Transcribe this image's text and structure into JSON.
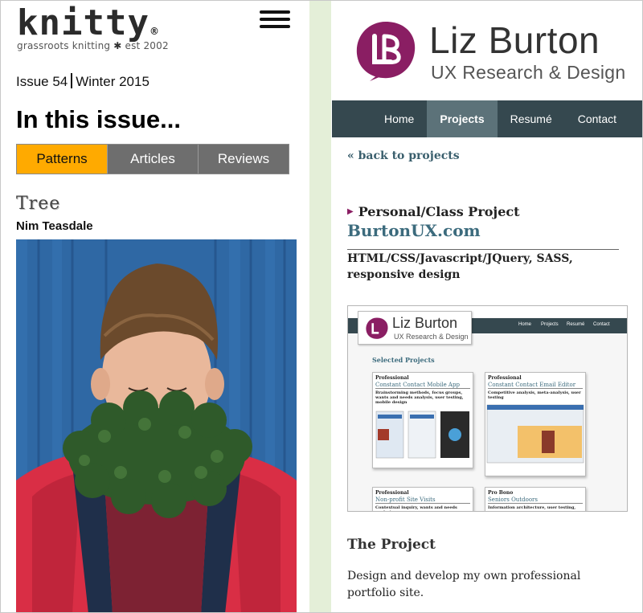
{
  "knitty": {
    "logo_word": "knitty",
    "logo_reg": "®",
    "tagline_left": "grassroots knitting",
    "tagline_star": "✱",
    "tagline_right": "est 2002",
    "issue": "Issue 54",
    "season": "Winter 2015",
    "heading": "In this issue...",
    "tabs": [
      {
        "label": "Patterns",
        "active": true
      },
      {
        "label": "Articles",
        "active": false
      },
      {
        "label": "Reviews",
        "active": false
      }
    ],
    "pattern_title": "Tree",
    "author": "Nim Teasdale",
    "colors": {
      "tab_active": "#ffaa00",
      "tab_inactive": "#6e6e6e"
    }
  },
  "portfolio": {
    "logo_initials": "LB",
    "name": "Liz Burton",
    "subtitle": "UX Research & Design",
    "nav": [
      {
        "label": "Home",
        "active": false
      },
      {
        "label": "Projects",
        "active": true
      },
      {
        "label": "Resumé",
        "active": false
      },
      {
        "label": "Contact",
        "active": false
      }
    ],
    "back_link": "« back to projects",
    "kicker": "Personal/Class Project",
    "site_title": "BurtonUX.com",
    "tech": "HTML/CSS/Javascript/JQuery, SASS, responsive design",
    "screenshot": {
      "name": "Liz Burton",
      "subtitle": "UX Research & Design",
      "nav": [
        "Home",
        "Projects",
        "Resumé",
        "Contact"
      ],
      "section": "Selected Projects",
      "cards": [
        {
          "kicker": "Professional",
          "title": "Constant Contact Mobile App",
          "desc": "Brainstorming methods, focus groups, wants and needs analysis, user testing, mobile design"
        },
        {
          "kicker": "Professional",
          "title": "Constant Contact Email Editor",
          "desc": "Competitive analysis, meta-analysis, user testing"
        },
        {
          "kicker": "Professional",
          "title": "Non-profit Site Visits",
          "desc": "Contextual inquiry, wants and needs analysis,"
        },
        {
          "kicker": "Pro Bono",
          "title": "Seniors Outdoors",
          "desc": "Information architecture, user testing,"
        }
      ]
    },
    "project_heading": "The Project",
    "description": "Design and develop my own professional portfolio site.",
    "colors": {
      "brand": "#8a1e63",
      "nav_bg": "#35484f",
      "nav_active": "#5c7279",
      "link": "#3c6b7d"
    }
  }
}
